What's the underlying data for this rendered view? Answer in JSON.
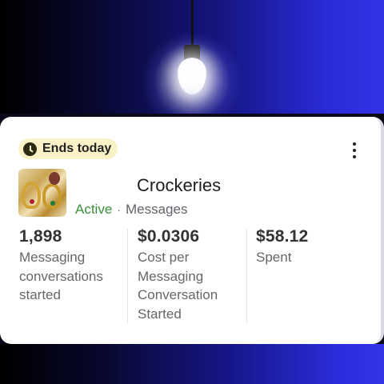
{
  "badge": {
    "label": "Ends today",
    "icon": "clock-icon"
  },
  "campaign": {
    "name": "Crockeries",
    "status": "Active",
    "status_color": "#3b8f3b",
    "separator": "·",
    "objective": "Messages"
  },
  "metrics": [
    {
      "value": "1,898",
      "label": [
        "Messaging",
        "conversations",
        "started"
      ]
    },
    {
      "value": "$0.0306",
      "label": [
        "Cost per",
        "Messaging",
        "Conversation",
        "Started"
      ]
    },
    {
      "value": "$58.12",
      "label": [
        "Spent"
      ]
    }
  ]
}
